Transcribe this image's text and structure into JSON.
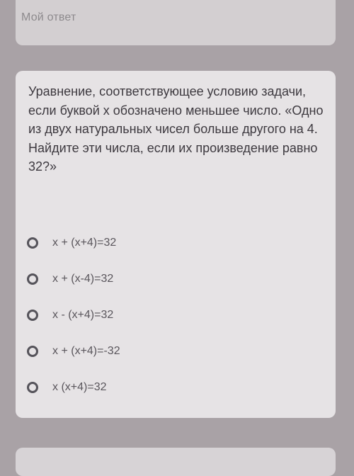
{
  "answer_card": {
    "label": "Мой ответ"
  },
  "question": {
    "text": "Уравнение, соответствующее условию задачи, если буквой x обозначено меньшее число. «Одно из двух натуральных чисел больше другого на 4. Найдите эти числа, если их произведение равно 32?»",
    "options": [
      {
        "label": "x + (x+4)=32"
      },
      {
        "label": "x + (x-4)=32"
      },
      {
        "label": "x - (x+4)=32"
      },
      {
        "label": "x + (x+4)=-32"
      },
      {
        "label": "x (x+4)=32"
      }
    ]
  }
}
